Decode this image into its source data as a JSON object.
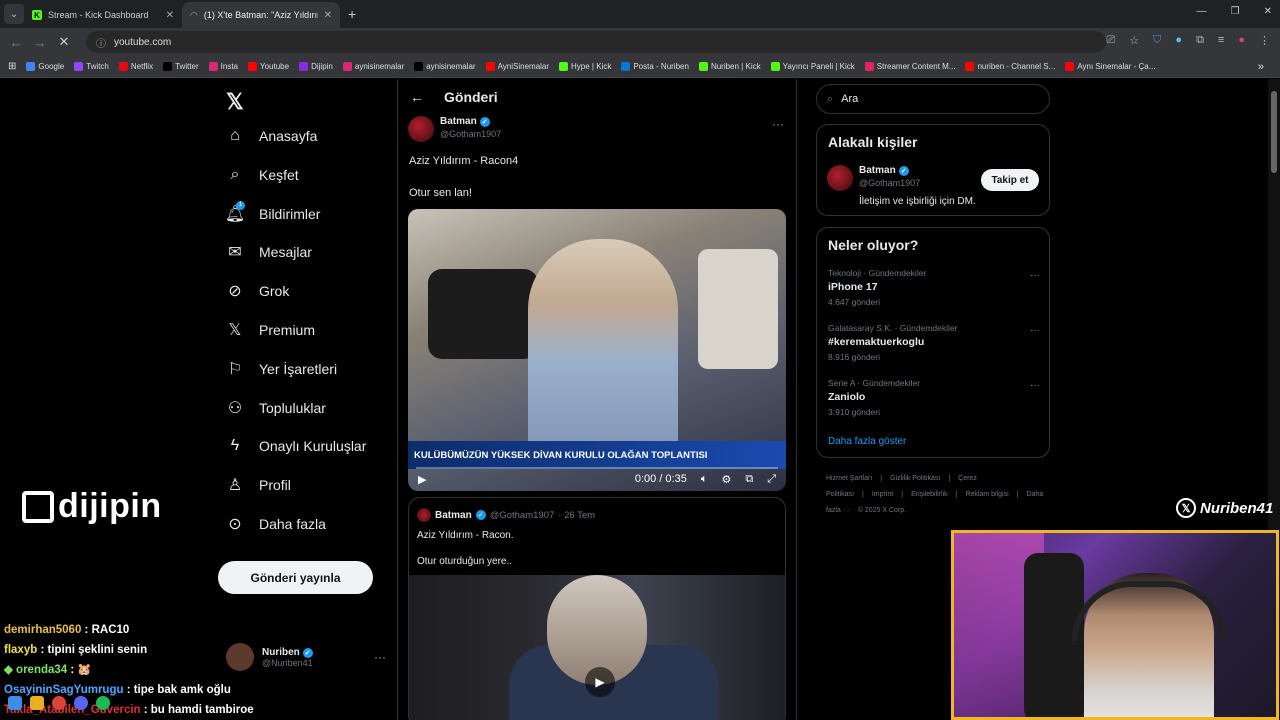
{
  "browser": {
    "tabs": [
      {
        "title": "Stream - Kick Dashboard",
        "active": false
      },
      {
        "title": "(1) X'te Batman: \"Aziz Yıldırım - ...",
        "active": true
      }
    ],
    "url": "youtube.com",
    "bookmarks": [
      {
        "label": "Google",
        "icon": "google-icon",
        "color": "#4285f4"
      },
      {
        "label": "Twitch",
        "icon": "twitch-icon",
        "color": "#9146ff"
      },
      {
        "label": "Netflix",
        "icon": "netflix-icon",
        "color": "#e50914"
      },
      {
        "label": "Twitter",
        "icon": "x-icon",
        "color": "#000000"
      },
      {
        "label": "Insta",
        "icon": "instagram-icon",
        "color": "#d62976"
      },
      {
        "label": "Youtube",
        "icon": "youtube-icon",
        "color": "#ff0000"
      },
      {
        "label": "Dijipin",
        "icon": "dijipin-icon",
        "color": "#8a2be2"
      },
      {
        "label": "aynisinemalar",
        "icon": "instagram-icon",
        "color": "#d62976"
      },
      {
        "label": "aynisinemalar",
        "icon": "x-icon",
        "color": "#000000"
      },
      {
        "label": "AyniSinemalar",
        "icon": "youtube-icon",
        "color": "#ff0000"
      },
      {
        "label": "Hype | Kick",
        "icon": "kick-icon",
        "color": "#53fc18"
      },
      {
        "label": "Posta - Nuriben",
        "icon": "outlook-icon",
        "color": "#0078d4"
      },
      {
        "label": "Nuriben | Kick",
        "icon": "kick-icon",
        "color": "#53fc18"
      },
      {
        "label": "Yayıncı Paneli | Kick",
        "icon": "kick-icon",
        "color": "#53fc18"
      },
      {
        "label": "Streamer Content M...",
        "icon": "content-icon",
        "color": "#e0245e"
      },
      {
        "label": "nuriben - Channel S...",
        "icon": "youtube-icon",
        "color": "#ff0000"
      },
      {
        "label": "Aynı Sinemalar - Ça...",
        "icon": "youtube-icon",
        "color": "#ff0000"
      }
    ]
  },
  "x": {
    "nav": [
      {
        "label": "Anasayfa",
        "icon": "home-icon"
      },
      {
        "label": "Keşfet",
        "icon": "search-icon"
      },
      {
        "label": "Bildirimler",
        "icon": "bell-icon",
        "badge": "1"
      },
      {
        "label": "Mesajlar",
        "icon": "mail-icon"
      },
      {
        "label": "Grok",
        "icon": "grok-icon"
      },
      {
        "label": "Premium",
        "icon": "x-premium-icon"
      },
      {
        "label": "Yer İşaretleri",
        "icon": "bookmark-icon"
      },
      {
        "label": "Topluluklar",
        "icon": "communities-icon"
      },
      {
        "label": "Onaylı Kuruluşlar",
        "icon": "lightning-icon"
      },
      {
        "label": "Profil",
        "icon": "person-icon"
      },
      {
        "label": "Daha fazla",
        "icon": "more-circle-icon"
      }
    ],
    "post_button": "Gönderi yayınla",
    "me": {
      "name": "Nuriben",
      "handle": "@Nuriben41"
    },
    "center": {
      "title": "Gönderi",
      "author": {
        "name": "Batman",
        "handle": "@Gotham1907"
      },
      "text1": "Aziz Yıldırım - Racon4",
      "text2": "Otur sen lan!",
      "video": {
        "caption": "KULÜBÜMÜZÜN YÜKSEK DİVAN KURULU OLAĞAN TOPLANTISI",
        "time": "0:00 / 0:35",
        "progress": 0
      },
      "quote": {
        "name": "Batman",
        "handle": "@Gotham1907",
        "date": "· 26 Tem",
        "text1": "Aziz Yıldırım - Racon.",
        "text2": "Otur oturduğun yere.."
      }
    },
    "right": {
      "search_placeholder": "Ara",
      "related_title": "Alakalı kişiler",
      "related": {
        "name": "Batman",
        "handle": "@Gotham1907",
        "bio": "İletişim ve işbirliği için DM.",
        "follow": "Takip et"
      },
      "trends_title": "Neler oluyor?",
      "trends": [
        {
          "category": "Teknoloji · Gündemdekiler",
          "title": "iPhone 17",
          "count": "4.647 gönderi"
        },
        {
          "category": "Galatasaray S.K. · Gündemdekiler",
          "title": "#keremaktuerkoglu",
          "count": "8.916 gönderi"
        },
        {
          "category": "Serie A · Gündemdekiler",
          "title": "Zaniolo",
          "count": "3.910 gönderi"
        }
      ],
      "show_more": "Daha fazla göster",
      "footer": [
        "Hizmet Şartları",
        "|",
        "Gizlilik Politikası",
        "|",
        "Çerez Politikası",
        "|",
        "Imprint",
        "|",
        "Erişilebilirlik",
        "|",
        "Reklam bilgisi",
        "|",
        "Daha fazla ···",
        "© 2025 X Corp."
      ]
    }
  },
  "overlay": {
    "brand": "dijipin",
    "watermark": "Nuriben41",
    "chat": [
      {
        "user": "demirhan5060",
        "color": "#e8c040",
        "msg": " : RAC10"
      },
      {
        "user": "flaxyb",
        "color": "#f0e040",
        "msg": " : tipini şeklini senin"
      },
      {
        "user": "orenda34",
        "color": "#80e060",
        "msg": " : 🐹",
        "prefix": "◆ "
      },
      {
        "user": "OsayininSagYumrugu",
        "color": "#4aa8ff",
        "msg": " : tipe bak amk oğlu"
      },
      {
        "user": "Takla_Atabilen_Guvercin",
        "color": "#e03030",
        "msg": " : bu hamdi tambiroe"
      }
    ]
  }
}
